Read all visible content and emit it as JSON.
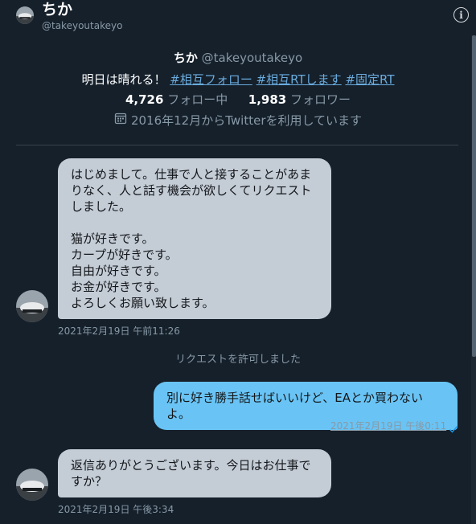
{
  "header": {
    "name": "ちか",
    "handle": "@takeyoutakeyo",
    "info_icon": "info-icon"
  },
  "profile": {
    "name": "ちか",
    "handle": "@takeyoutakeyo",
    "bio_text": "明日は晴れる！",
    "hashtags": [
      "#相互フォロー",
      "#相互RTします",
      "#固定RT"
    ],
    "following_count": "4,726",
    "following_label": "フォロー中",
    "followers_count": "1,983",
    "followers_label": "フォロワー",
    "joined": "2016年12月からTwitterを利用しています",
    "calendar_icon": "calendar-icon"
  },
  "messages": [
    {
      "direction": "received",
      "text": "はじめまして。仕事で人と接することがあまりなく、人と話す機会が欲しくてリクエストしました。\n\n猫が好きです。\nカープが好きです。\n自由が好きです。\nお金が好きです。\nよろしくお願い致します。",
      "timestamp": "2021年2月19日 午前11:26"
    },
    {
      "direction": "system",
      "text": "リクエストを許可しました"
    },
    {
      "direction": "sent",
      "text": "別に好き勝手話せばいいけど、EAとか買わないよ。",
      "timestamp": "2021年2月19日 午後0:11",
      "status_icon": "read-check-icon"
    },
    {
      "direction": "received",
      "text": "返信ありがとうございます。今日はお仕事ですか？",
      "timestamp": "2021年2月19日 午後3:34"
    }
  ],
  "colors": {
    "background": "#15202b",
    "received_bubble": "#c4ccd6",
    "sent_bubble": "#69c4f5",
    "link": "#6aabdd",
    "muted": "#8899a6"
  }
}
